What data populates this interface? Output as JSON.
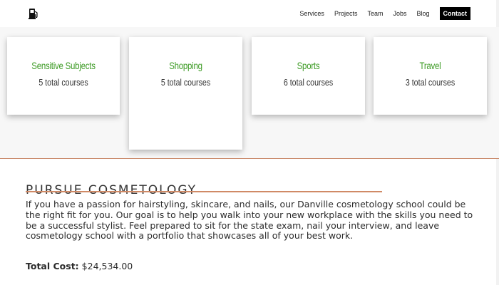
{
  "nav": {
    "items": [
      "Services",
      "Projects",
      "Team",
      "Jobs",
      "Blog"
    ],
    "contact_label": "Contact"
  },
  "logo_icon": "fuel-pump-icon",
  "cards": [
    {
      "title": "Sensitive Subjects",
      "count": "5 total courses"
    },
    {
      "title": "Shopping",
      "count": "5 total courses"
    },
    {
      "title": "Sports",
      "count": "6 total courses"
    },
    {
      "title": "Travel",
      "count": "3 total courses"
    }
  ],
  "section": {
    "title": "PURSUE COSMETOLOGY",
    "body": "If you have a passion for hairstyling, skincare, and nails, our Danville cosmetology school could be the right fit for you. Our goal is to help you walk into your new workplace with the skills you need to be a successful stylist. Feel prepared to sit for the state exam, nail your interview, and leave cosmetology school with a portfolio that showcases all of your best work.",
    "cost_label": "Total Cost:",
    "cost_value": "$24,534.00"
  },
  "colors": {
    "card_title": "#3d9b25",
    "accent_line": "#d08a66",
    "contact_bg": "#000000"
  }
}
